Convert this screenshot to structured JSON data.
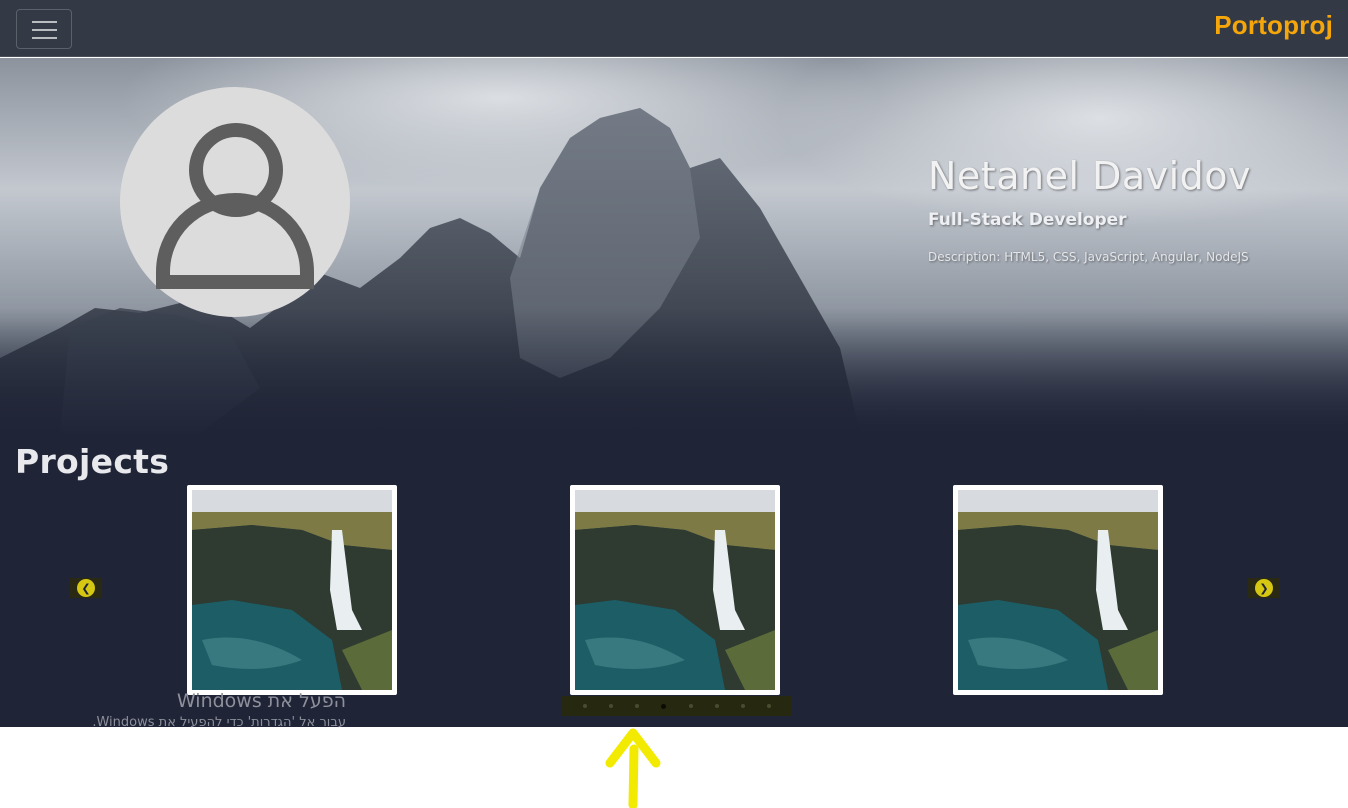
{
  "navbar": {
    "brand": "Portoproj",
    "brand_color": "#f5a60a",
    "menu_icon": "hamburger-icon"
  },
  "hero": {
    "name": "Netanel Davidov",
    "title": "Full-Stack Developer",
    "description": "Description: HTML5, CSS, JavaScript, Angular, NodeJS",
    "avatar_icon": "user-icon"
  },
  "projects": {
    "heading": "Projects",
    "cards": [
      {
        "image": "waterfall-cliff-photo"
      },
      {
        "image": "waterfall-cliff-photo"
      },
      {
        "image": "waterfall-cliff-photo"
      }
    ],
    "prev_icon": "chevron-left-icon",
    "next_icon": "chevron-right-icon",
    "indicator_count": 8,
    "active_indicator": 4
  },
  "watermark": {
    "title": "הפעל את Windows",
    "subtitle": "עבור אל 'הגדרות' כדי להפעיל את Windows."
  },
  "annotation": {
    "icon": "arrow-up-icon",
    "color": "#f2ea00"
  }
}
